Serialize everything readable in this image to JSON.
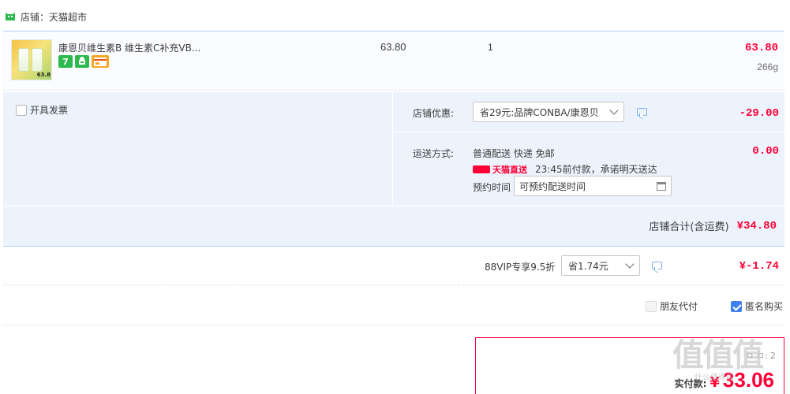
{
  "shop": {
    "label": "店铺：天猫超市"
  },
  "item": {
    "title": "康恩贝维生素B 维生素C补充VB...",
    "thumb_price": "63.8",
    "badges": [
      {
        "name": "seven-day-return-badge",
        "text": "7",
        "color": "#2db94d"
      },
      {
        "name": "android-badge",
        "text": "",
        "color": "#2db94d"
      },
      {
        "name": "card-badge",
        "text": "",
        "color": "#f5a623"
      }
    ],
    "unit_price": "63.80",
    "quantity": "1",
    "line_total": "63.80",
    "weight": "266g"
  },
  "invoice": {
    "label": "开具发票",
    "checked": false
  },
  "shop_discount": {
    "label": "店铺优惠:",
    "selected": "省29元:品牌CONBA/康恩贝",
    "amount": "-29.00"
  },
  "delivery": {
    "label": "运送方式:",
    "method": "普通配送 快递 免邮",
    "amount": "0.00",
    "tmall_direct": "天猫直送",
    "promise": "23:45前付款，承诺明天送达",
    "reserve_label": "预约时间",
    "reserve_placeholder": "可预约配送时间"
  },
  "shop_total": {
    "label": "店铺合计(含运费)",
    "amount": "¥34.80"
  },
  "vip": {
    "label": "88VIP专享9.5折",
    "selected": "省1.74元",
    "amount": "¥-1.74"
  },
  "options": {
    "friend_pay": "朋友代付",
    "friend_pay_checked": false,
    "anonymous": "匿名购买",
    "anonymous_checked": true
  },
  "payment": {
    "label": "实付款:",
    "currency": "¥",
    "amount": "33.06",
    "partial_top": "ㅁ  ㅁ:  2"
  },
  "watermark": {
    "text": "值值值",
    "sub": "什么值得买"
  }
}
